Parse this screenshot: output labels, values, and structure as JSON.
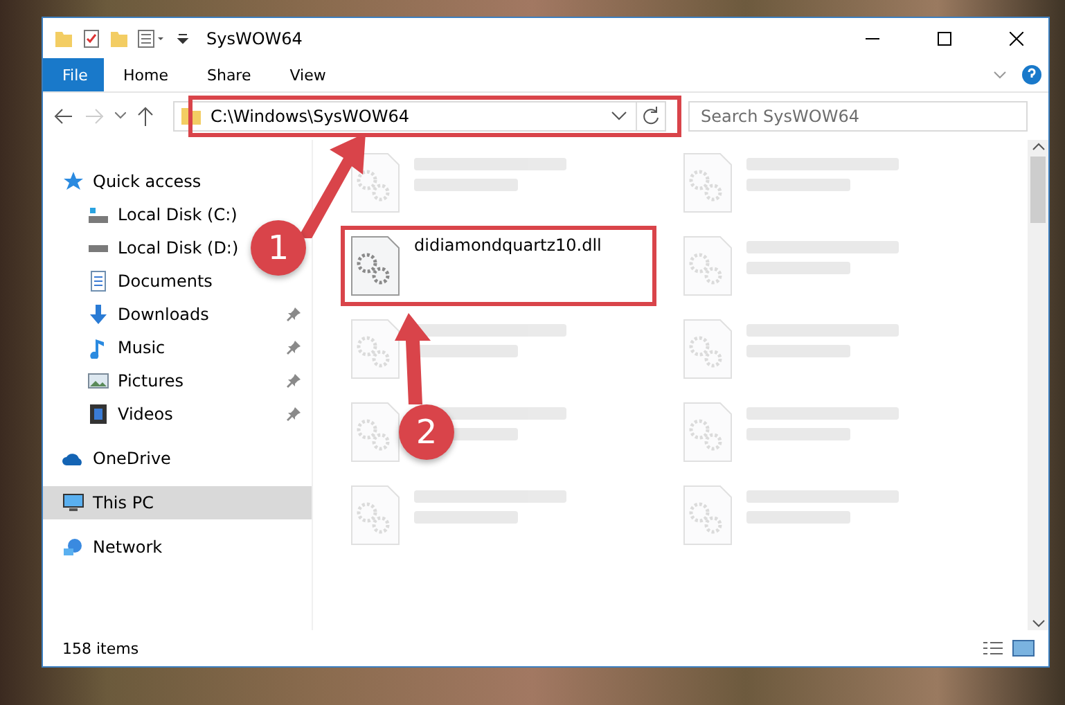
{
  "window": {
    "title": "SysWOW64"
  },
  "ribbon": {
    "tabs": [
      {
        "label": "File",
        "selected": true
      },
      {
        "label": "Home",
        "selected": false
      },
      {
        "label": "Share",
        "selected": false
      },
      {
        "label": "View",
        "selected": false
      }
    ]
  },
  "address_bar": {
    "path": "C:\\Windows\\SysWOW64"
  },
  "search": {
    "placeholder": "Search SysWOW64"
  },
  "sidebar": {
    "items": [
      {
        "label": "Quick access",
        "kind": "star",
        "pinned": false,
        "selected": false,
        "group": true
      },
      {
        "label": "Local Disk (C:)",
        "kind": "disk-system",
        "pinned": false,
        "selected": false,
        "group": false
      },
      {
        "label": "Local Disk (D:)",
        "kind": "disk",
        "pinned": false,
        "selected": false,
        "group": false
      },
      {
        "label": "Documents",
        "kind": "documents",
        "pinned": false,
        "selected": false,
        "group": false
      },
      {
        "label": "Downloads",
        "kind": "downloads",
        "pinned": true,
        "selected": false,
        "group": false
      },
      {
        "label": "Music",
        "kind": "music",
        "pinned": true,
        "selected": false,
        "group": false
      },
      {
        "label": "Pictures",
        "kind": "pictures",
        "pinned": true,
        "selected": false,
        "group": false
      },
      {
        "label": "Videos",
        "kind": "videos",
        "pinned": true,
        "selected": false,
        "group": false
      },
      {
        "label": "OneDrive",
        "kind": "cloud",
        "pinned": false,
        "selected": false,
        "group": true
      },
      {
        "label": "This PC",
        "kind": "pc",
        "pinned": false,
        "selected": true,
        "group": true
      },
      {
        "label": "Network",
        "kind": "network",
        "pinned": false,
        "selected": false,
        "group": true
      }
    ]
  },
  "files": [
    {
      "blurred": true
    },
    {
      "blurred": true
    },
    {
      "name": "didiamondquartz10.dll",
      "blurred": false,
      "highlighted": true
    },
    {
      "blurred": true
    },
    {
      "blurred": true
    },
    {
      "blurred": true
    },
    {
      "blurred": true
    },
    {
      "blurred": true
    },
    {
      "blurred": true
    },
    {
      "blurred": true
    }
  ],
  "status_bar": {
    "count": "158 items"
  },
  "annotations": [
    {
      "number": "1"
    },
    {
      "number": "2"
    }
  ]
}
